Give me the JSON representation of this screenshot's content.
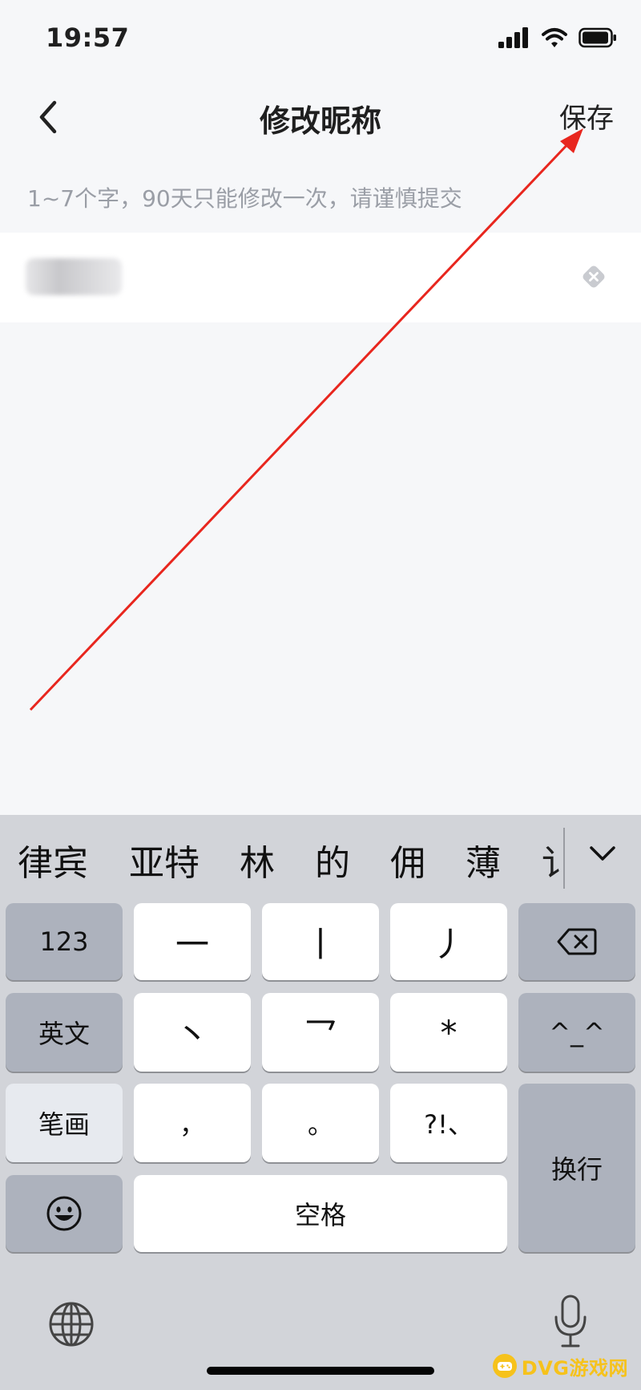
{
  "status_bar": {
    "time": "19:57",
    "icons": [
      "cellular-signal-icon",
      "wifi-icon",
      "battery-icon"
    ]
  },
  "nav": {
    "back_icon": "chevron-left-icon",
    "title": "修改昵称",
    "save_label": "保存"
  },
  "form": {
    "hint": "1~7个字，90天只能修改一次，请谨慎提交",
    "clear_icon": "clear-icon"
  },
  "keyboard": {
    "candidates": [
      "律宾",
      "亚特",
      "林",
      "的",
      "佣",
      "薄",
      "讠"
    ],
    "expand_icon": "chevron-down-icon",
    "keys": {
      "numbers": "123",
      "english": "英文",
      "stroke_mode": "笔画",
      "emoji_icon": "emoji-icon",
      "stroke_heng": "一",
      "stroke_shu": "丨",
      "stroke_pie": "丿",
      "stroke_dian": "丶",
      "stroke_zhe": "乛",
      "wildcard": "*",
      "comma": "，",
      "period": "。",
      "punctuation": "?!、",
      "space": "空格",
      "emoticon": "^_^",
      "newline": "换行",
      "backspace_icon": "backspace-icon"
    },
    "globe_icon": "globe-icon",
    "mic_icon": "microphone-icon"
  },
  "watermark": {
    "text": "DVG游戏网"
  },
  "colors": {
    "background": "#f6f7f9",
    "keyboard_bg": "#d2d4d9",
    "dark_key": "#adb2bd",
    "annotation_arrow": "#e8261e",
    "hint_text": "#9a9ea6"
  }
}
